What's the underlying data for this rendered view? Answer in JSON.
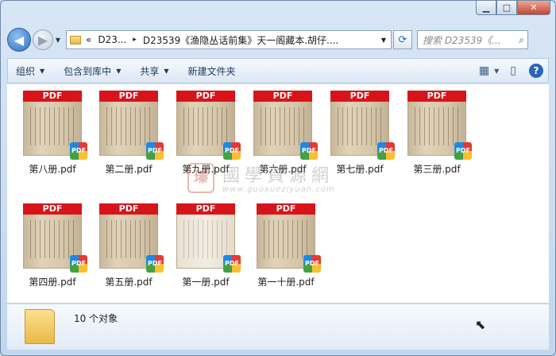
{
  "window": {
    "minimize_label": "▁",
    "maximize_label": "□",
    "close_label": "✕"
  },
  "nav": {
    "back_symbol": "◀",
    "forward_symbol": "▶",
    "dropdown_symbol": "▼"
  },
  "address": {
    "chevrons": "«",
    "crumb_1": "D23...",
    "separator": "▸",
    "crumb_2": "D23539《渔隐丛话前集》天一阁藏本.胡仔....",
    "dropdown_symbol": "▼",
    "refresh_symbol": "⟳"
  },
  "search": {
    "placeholder": "搜索 D23539《...",
    "icon_symbol": "⌕"
  },
  "toolbar": {
    "organize": "组织",
    "include_library": "包含到库中",
    "share": "共享",
    "new_folder": "新建文件夹",
    "caret": "▼",
    "view_symbol": "▦",
    "pane_symbol": "▯",
    "help_symbol": "?"
  },
  "files": [
    {
      "name": "第八册.pdf",
      "badge": "PDF"
    },
    {
      "name": "第二册.pdf",
      "badge": "PDF"
    },
    {
      "name": "第九册.pdf",
      "badge": "PDF"
    },
    {
      "name": "第六册.pdf",
      "badge": "PDF"
    },
    {
      "name": "第七册.pdf",
      "badge": "PDF"
    },
    {
      "name": "第三册.pdf",
      "badge": "PDF"
    },
    {
      "name": "第四册.pdf",
      "badge": "PDF"
    },
    {
      "name": "第五册.pdf",
      "badge": "PDF"
    },
    {
      "name": "第一册.pdf",
      "badge": "PDF"
    },
    {
      "name": "第一十册.pdf",
      "badge": "PDF"
    }
  ],
  "watermark": {
    "logo_char": "瑧",
    "title": "國學資源網",
    "url": "www.guoxueziyuan.com"
  },
  "status": {
    "count_text": "10 个对象"
  },
  "colors": {
    "pdf_red": "#d8141b",
    "chrome_blue": "#c2d6ee"
  }
}
